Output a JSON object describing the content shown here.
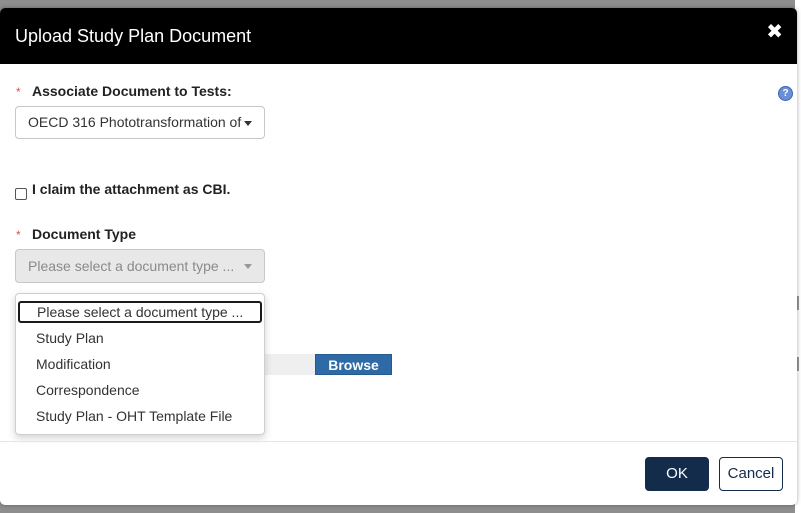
{
  "modal": {
    "title": "Upload Study Plan Document",
    "close_icon": "✖"
  },
  "form": {
    "associate_label": "Associate Document to Tests:",
    "associate_value": "OECD 316 Phototransformation of",
    "cbi_label": "I claim the attachment as CBI.",
    "cbi_checked": false,
    "doc_type_label": "Document Type",
    "doc_type_value": "Please select a document type ...",
    "required_marker": "*",
    "help_icon": "?",
    "browse_label": "Browse"
  },
  "dropdown": {
    "options": [
      "Please select a document type ...",
      "Study Plan",
      "Modification",
      "Correspondence",
      "Study Plan - OHT Template File"
    ],
    "highlighted_index": 0
  },
  "footer": {
    "ok_label": "OK",
    "cancel_label": "Cancel"
  },
  "colors": {
    "header_bg": "#000000",
    "primary_button": "#142c4c",
    "browse_button": "#2e6aa6",
    "required": "#d9534f"
  }
}
